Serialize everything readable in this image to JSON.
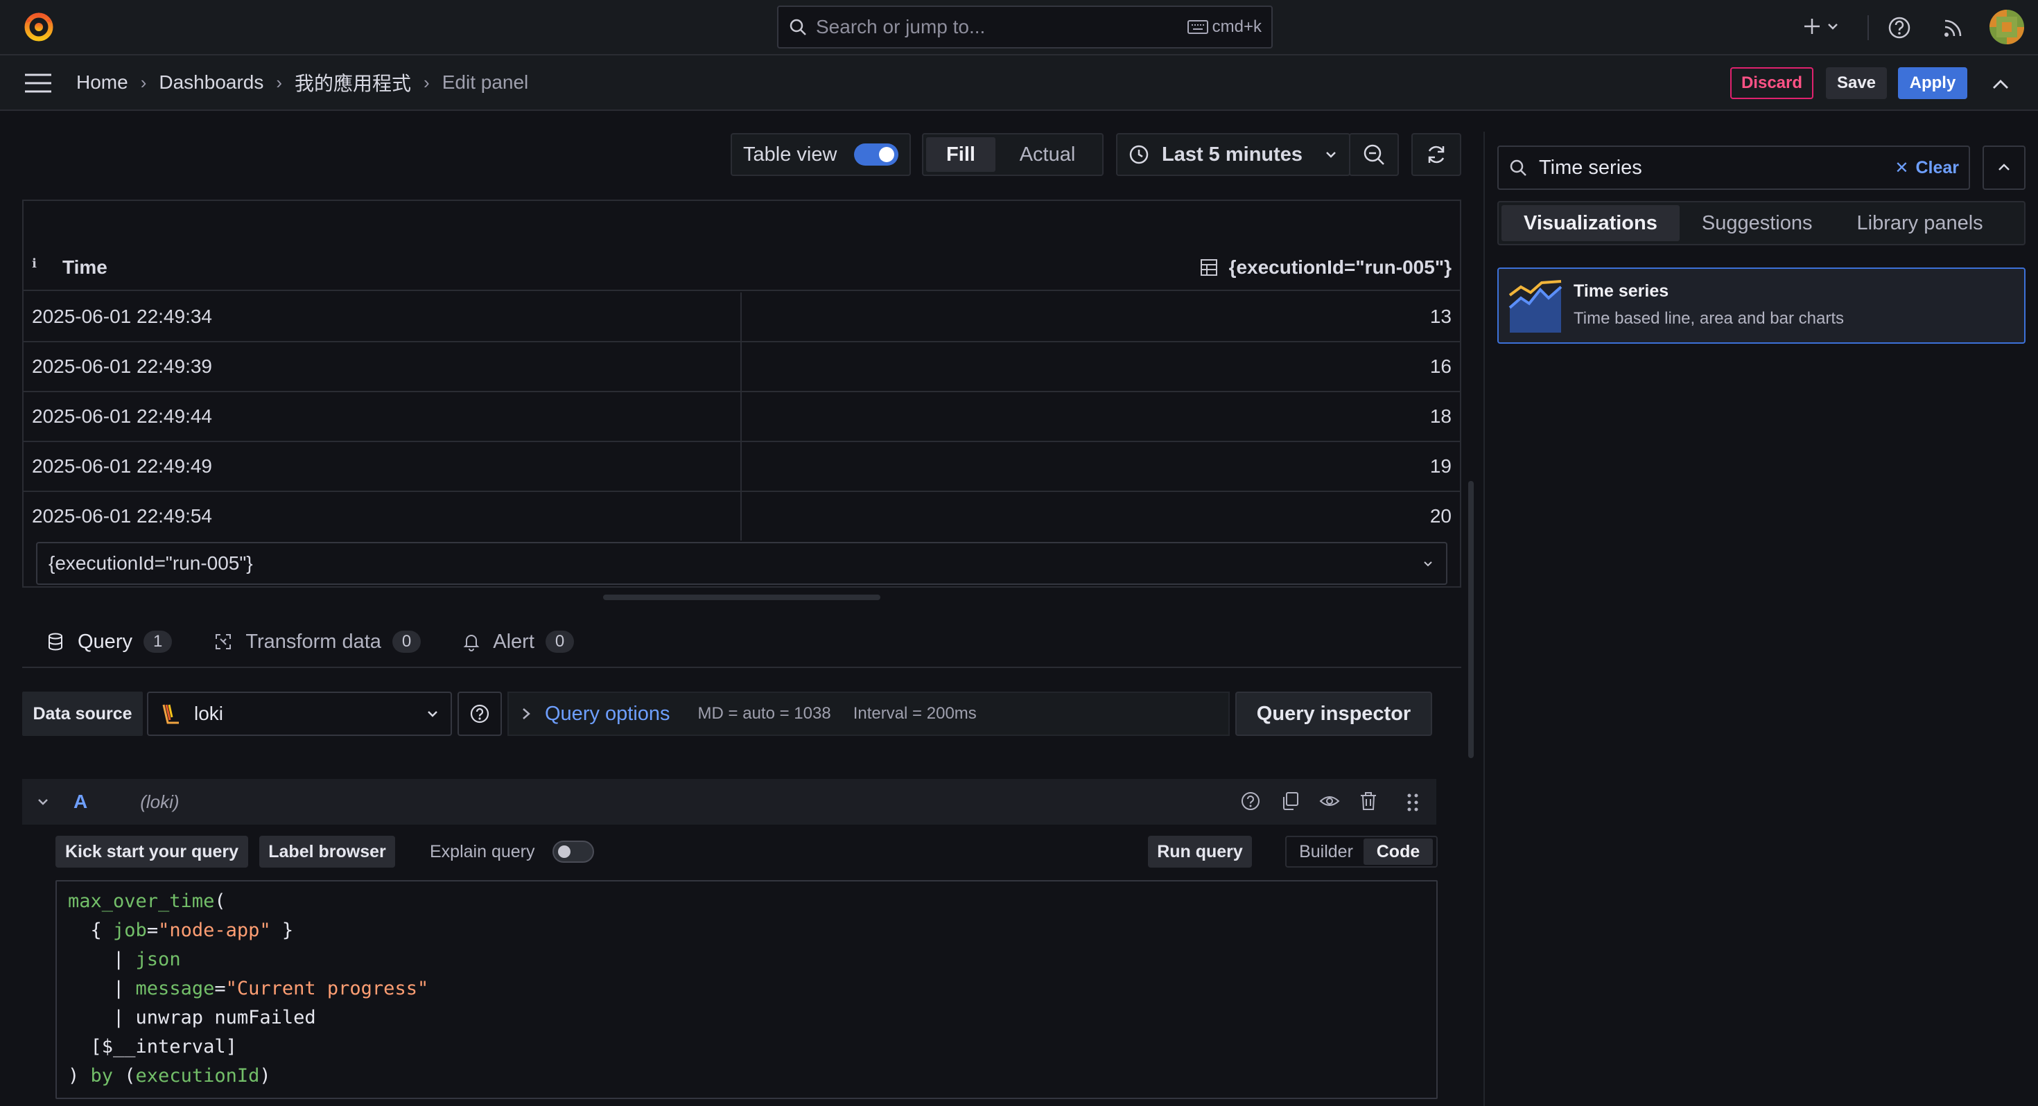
{
  "topbar": {
    "search_placeholder": "Search or jump to...",
    "shortcut": "cmd+k"
  },
  "breadcrumbs": [
    "Home",
    "Dashboards",
    "我的應用程式",
    "Edit panel"
  ],
  "actions": {
    "discard": "Discard",
    "save": "Save",
    "apply": "Apply"
  },
  "toolbar": {
    "table_view_label": "Table view",
    "table_view_on": true,
    "fill": "Fill",
    "actual": "Actual",
    "time_range": "Last 5 minutes"
  },
  "table": {
    "col_time": "Time",
    "col_value": "{executionId=\"run-005\"}",
    "rows": [
      {
        "time": "2025-06-01 22:49:34",
        "value": "13"
      },
      {
        "time": "2025-06-01 22:49:39",
        "value": "16"
      },
      {
        "time": "2025-06-01 22:49:44",
        "value": "18"
      },
      {
        "time": "2025-06-01 22:49:49",
        "value": "19"
      },
      {
        "time": "2025-06-01 22:49:54",
        "value": "20"
      }
    ],
    "series_select": "{executionId=\"run-005\"}"
  },
  "tabs": [
    {
      "label": "Query",
      "count": "1"
    },
    {
      "label": "Transform data",
      "count": "0"
    },
    {
      "label": "Alert",
      "count": "0"
    }
  ],
  "query": {
    "datasource_label": "Data source",
    "datasource": "loki",
    "options_label": "Query options",
    "md": "MD = auto = 1038",
    "interval": "Interval = 200ms",
    "inspector": "Query inspector",
    "ref": "A",
    "ref_ds": "(loki)",
    "kick_start": "Kick start your query",
    "label_browser": "Label browser",
    "explain": "Explain query",
    "run": "Run query",
    "builder": "Builder",
    "code": "Code"
  },
  "viz": {
    "search_value": "Time series",
    "clear": "Clear",
    "tabs": [
      "Visualizations",
      "Suggestions",
      "Library panels"
    ],
    "card_title": "Time series",
    "card_desc": "Time based line, area and bar charts"
  },
  "colors": {
    "accent": "#3d71d9",
    "danger": "#ff5286",
    "orange": "#ff8833"
  }
}
